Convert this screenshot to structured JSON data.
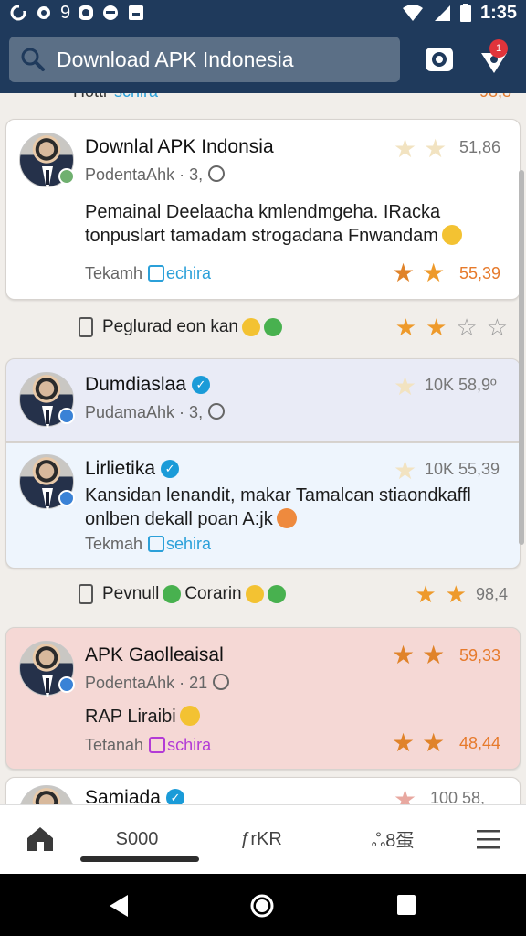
{
  "status_bar": {
    "left_text": "9",
    "time": "1:35"
  },
  "search": {
    "text": "Download APK Indonesia"
  },
  "notification_badge": "1",
  "peek_top": {
    "label": "Hotti",
    "link": "schira",
    "rating": "98,8"
  },
  "posts": [
    {
      "name": "Downlal APK Indonsia",
      "sub": "PodentaAhk · 3,",
      "body": "Pemainal Deelaacha kmlendmgeha. IRacka tonpuslart tamadam strogadana Fnwandam",
      "tag_prefix": "Tekamh",
      "tag_link": "echira",
      "rating_top": "51,86",
      "rating_bottom": "55,39"
    },
    {
      "name": "Dumdiaslaa",
      "sub": "PudamaAhk · 3,",
      "rating_top": "10K 58,9º"
    },
    {
      "name": "Lirlietika",
      "body": "Kansidan lenandit, makar Tamalcan stiaondkaffl onlben dekall poan A:jk",
      "tag_prefix": "Tekmah",
      "tag_link": "sehira",
      "rating_top": "10K 55,39"
    },
    {
      "name": "APK Gaolleaisal",
      "sub": "PodentaAhk · 21",
      "body": "RAP Liraibi",
      "tag_prefix": "Tetanah",
      "tag_link": "schira",
      "rating_top": "59,33",
      "rating_bottom": "48,44"
    },
    {
      "name": "Samiada",
      "rating_top": "100 58,"
    }
  ],
  "meta_rows": [
    {
      "text": "Peglurad eon kan"
    },
    {
      "text": "Pevnull",
      "text2": "Corarin",
      "rating": "98,4"
    }
  ],
  "bottom_nav": {
    "item2": "S000",
    "item3": "ƒrKR",
    "item4": "ஃ8蛋"
  },
  "colors": {
    "appbar": "#1f3a5c",
    "search_bg": "#5b6f86",
    "star": "#ee9a2b",
    "link": "#2ba0d9",
    "link_purple": "#b33bd6",
    "pink_card": "#f5d8d5"
  }
}
